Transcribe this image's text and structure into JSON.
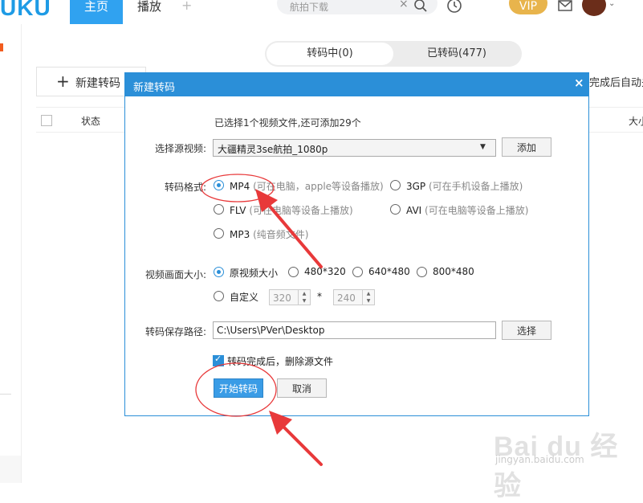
{
  "app": {
    "logo": "UKU"
  },
  "nav": {
    "home": "主页",
    "play": "播放",
    "add": "+"
  },
  "search": {
    "placeholder": "航拍下载",
    "clear": "×"
  },
  "vip": "VIP",
  "avatar_caret": "⌄",
  "tabs": {
    "transcoding": "转码中(0)",
    "transcoded": "已转码(477)"
  },
  "toolbar": {
    "new_plus": "+",
    "new_label": "新建转码",
    "right_note": "完成后自动关"
  },
  "list_header": {
    "status": "状态",
    "size": "大小"
  },
  "dialog": {
    "title": "新建转码",
    "close": "×",
    "info": "已选择1个视频文件,还可添加29个",
    "source_label": "选择源视频:",
    "source_value": "大疆精灵3se航拍_1080p",
    "add_button": "添加",
    "format_label": "转码格式:",
    "formats": [
      {
        "name": "MP4",
        "hint": "(可在电脑，apple等设备播放)",
        "selected": true
      },
      {
        "name": "3GP",
        "hint": "(可在手机设备上播放)",
        "selected": false
      },
      {
        "name": "FLV",
        "hint": "(可在电脑等设备上播放)",
        "selected": false
      },
      {
        "name": "AVI",
        "hint": "(可在电脑等设备上播放)",
        "selected": false
      },
      {
        "name": "MP3",
        "hint": "(纯音频文件)",
        "selected": false
      }
    ],
    "size_label": "视频画面大小:",
    "sizes": [
      {
        "name": "原视频大小",
        "selected": true
      },
      {
        "name": "480*320",
        "selected": false
      },
      {
        "name": "640*480",
        "selected": false
      },
      {
        "name": "800*480",
        "selected": false
      }
    ],
    "custom_label": "自定义",
    "custom_width": "320",
    "custom_times": "*",
    "custom_height": "240",
    "path_label": "转码保存路径:",
    "path_value": "C:\\Users\\PVer\\Desktop",
    "browse_button": "选择",
    "delete_source_label": "转码完成后，删除源文件",
    "delete_source_checked": true,
    "start_button": "开始转码",
    "cancel_button": "取消"
  },
  "watermark": {
    "main": "Bai du 经验",
    "sub": "jingyan.baidu.com"
  },
  "colors": {
    "accent": "#2b8fd8",
    "annotation": "#e8393a",
    "vip": "#e8b44c"
  }
}
